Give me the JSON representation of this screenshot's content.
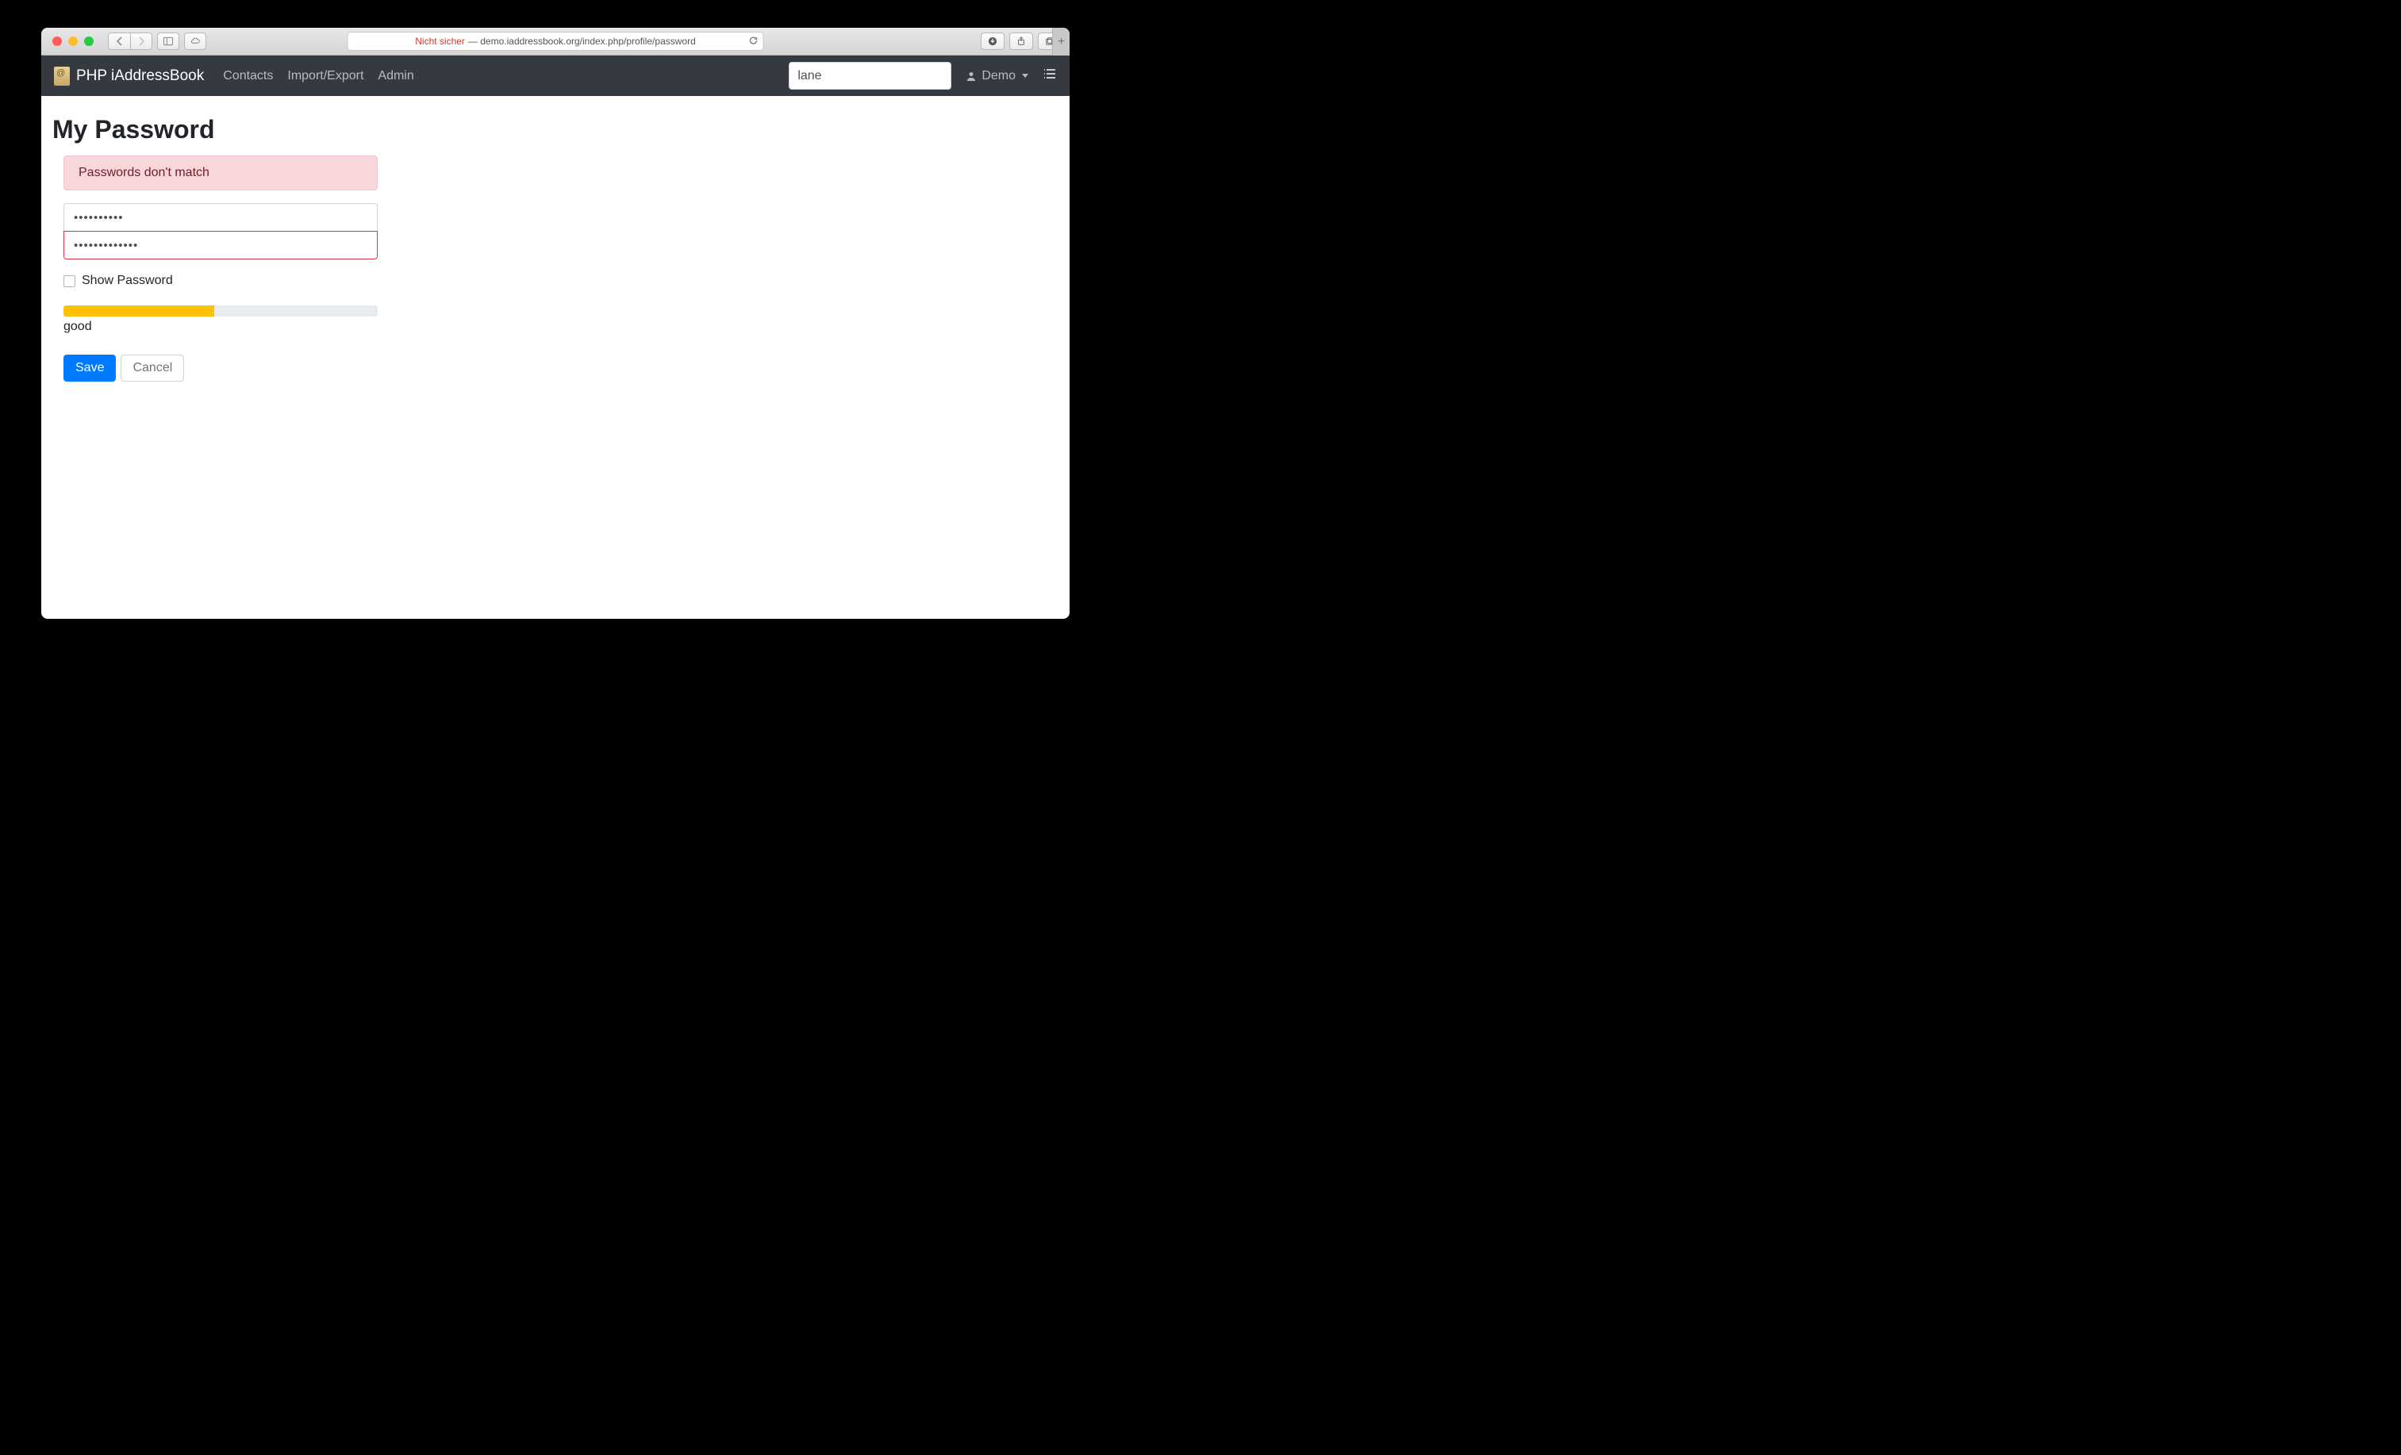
{
  "browser": {
    "insecure_label": "Nicht sicher",
    "url_display": " — demo.iaddressbook.org/index.php/profile/password"
  },
  "navbar": {
    "brand": "PHP iAddressBook",
    "links": {
      "contacts": "Contacts",
      "import_export": "Import/Export",
      "admin": "Admin"
    },
    "search_value": "lane",
    "user_label": "Demo"
  },
  "page": {
    "title": "My Password",
    "alert": "Passwords don't match",
    "password1": "••••••••••",
    "password2": "•••••••••••••",
    "show_password_label": "Show Password",
    "strength_percent": 48,
    "strength_label": "good",
    "save_label": "Save",
    "cancel_label": "Cancel"
  }
}
